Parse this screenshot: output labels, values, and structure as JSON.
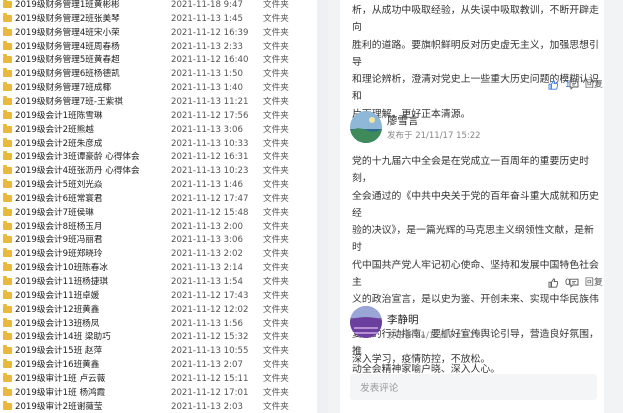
{
  "explorer": {
    "rows": [
      {
        "name": "2019级财务管理1班黄彬彬",
        "date": "2021-11-18 9:47",
        "type": "文件夹"
      },
      {
        "name": "2019级财务管理2班张美琴",
        "date": "2021-11-13 1:45",
        "type": "文件夹"
      },
      {
        "name": "2019级财务管理4班宋小荣",
        "date": "2021-11-12 16:39",
        "type": "文件夹"
      },
      {
        "name": "2019级财务管理4班周春杨",
        "date": "2021-11-13 2:33",
        "type": "文件夹"
      },
      {
        "name": "2019级财务管理5班黄春超",
        "date": "2021-11-12 16:40",
        "type": "文件夹"
      },
      {
        "name": "2019级财务管理6班杨德凯",
        "date": "2021-11-13 1:50",
        "type": "文件夹"
      },
      {
        "name": "2019级财务管理7班成椰",
        "date": "2021-11-13 1:40",
        "type": "文件夹"
      },
      {
        "name": "2019级财务管理7班-王紫祺",
        "date": "2021-11-13 11:21",
        "type": "文件夹"
      },
      {
        "name": "2019级会计1班陈雪琳",
        "date": "2021-11-12 17:56",
        "type": "文件夹"
      },
      {
        "name": "2019级会计2班熊越",
        "date": "2021-11-13 3:06",
        "type": "文件夹"
      },
      {
        "name": "2019级会计2班朱彦成",
        "date": "2021-11-13 10:33",
        "type": "文件夹"
      },
      {
        "name": "2019级会计3班谭豪龄 心得体会",
        "date": "2021-11-12 16:31",
        "type": "文件夹"
      },
      {
        "name": "2019级会计4班张沥丹 心得体会",
        "date": "2021-11-13 10:23",
        "type": "文件夹"
      },
      {
        "name": "2019级会计5班刘光焱",
        "date": "2021-11-13 1:46",
        "type": "文件夹"
      },
      {
        "name": "2019级会计6班常寰君",
        "date": "2021-11-12 17:47",
        "type": "文件夹"
      },
      {
        "name": "2019级会计7班侯琳",
        "date": "2021-11-12 15:48",
        "type": "文件夹"
      },
      {
        "name": "2019级会计8班杨玉月",
        "date": "2021-11-13 2:00",
        "type": "文件夹"
      },
      {
        "name": "2019级会计9班冯丽君",
        "date": "2021-11-13 3:06",
        "type": "文件夹"
      },
      {
        "name": "2019级会计9班郑晓玲",
        "date": "2021-11-13 2:02",
        "type": "文件夹"
      },
      {
        "name": "2019级会计10班陈春冰",
        "date": "2021-11-13 2:14",
        "type": "文件夹"
      },
      {
        "name": "2019级会计11班杨捷琪",
        "date": "2021-11-13 1:54",
        "type": "文件夹"
      },
      {
        "name": "2019级会计11班卓媛",
        "date": "2021-11-12 17:43",
        "type": "文件夹"
      },
      {
        "name": "2019级会计12班黄鑫",
        "date": "2021-11-12 12:02",
        "type": "文件夹"
      },
      {
        "name": "2019级会计13班杨凤",
        "date": "2021-11-13 1:56",
        "type": "文件夹"
      },
      {
        "name": "2019级会计14班 梁助巧",
        "date": "2021-11-12 15:32",
        "type": "文件夹"
      },
      {
        "name": "2019级会计15班 赵萍",
        "date": "2021-11-13 10:55",
        "type": "文件夹"
      },
      {
        "name": "2019级会计16班黄鑫",
        "date": "2021-11-13 2:07",
        "type": "文件夹"
      },
      {
        "name": "2019级审计1班 卢云薇",
        "date": "2021-11-12 15:11",
        "type": "文件夹"
      },
      {
        "name": "2019级审计1班 杨鸿霞",
        "date": "2021-11-12 17:01",
        "type": "文件夹"
      },
      {
        "name": "2019级审计2班谢薇莹",
        "date": "2021-11-13 2:03",
        "type": "文件夹"
      }
    ]
  },
  "comments": [
    {
      "text_lines": [
        "析，从成功中吸取经验，从失误中吸取教训，不断开辟走向",
        "胜利的道路。要旗帜鲜明反对历史虚无主义，加强思想引导",
        "和理论辨析，澄清对党史上一些重大历史问题的模糊认识和",
        "片面理解，更好正本清源。"
      ],
      "likes": "1",
      "reply_label": "回复"
    },
    {
      "author": "廖雪言",
      "posted": "发布于 21/11/17 15:22",
      "text_lines": [
        "党的十九届六中全会是在党成立一百周年的重要历史时刻，",
        "全会通过的《中共中央关于党的百年奋斗重大成就和历史经",
        "验的决议》，是一篇光辉的马克思主义纲领性文献，是新时",
        "代中国共产党人牢记初心使命、坚持和发展中国特色社会主",
        "义的政治宣言，是以史为鉴、开创未来、实现中华民族伟大",
        "复兴的行动指南。要抓好宣传舆论引导，营造良好氛围，推",
        "动全会精神家喻户晓、深入人心。"
      ],
      "likes": "0",
      "reply_label": "回复"
    },
    {
      "author": "李静明",
      "posted": "发布于 21/11/17 11:20",
      "text_lines": [
        "深入学习，疫情防控，不放松。"
      ]
    }
  ],
  "comment_input": {
    "placeholder": "发表评论"
  },
  "colors": {
    "like_blue": "#3d7be0",
    "folder": "#e9b93b"
  },
  "icons": {
    "folder": "folder-icon",
    "like": "thumbs-up-icon",
    "reply": "comment-bubble-icon"
  }
}
